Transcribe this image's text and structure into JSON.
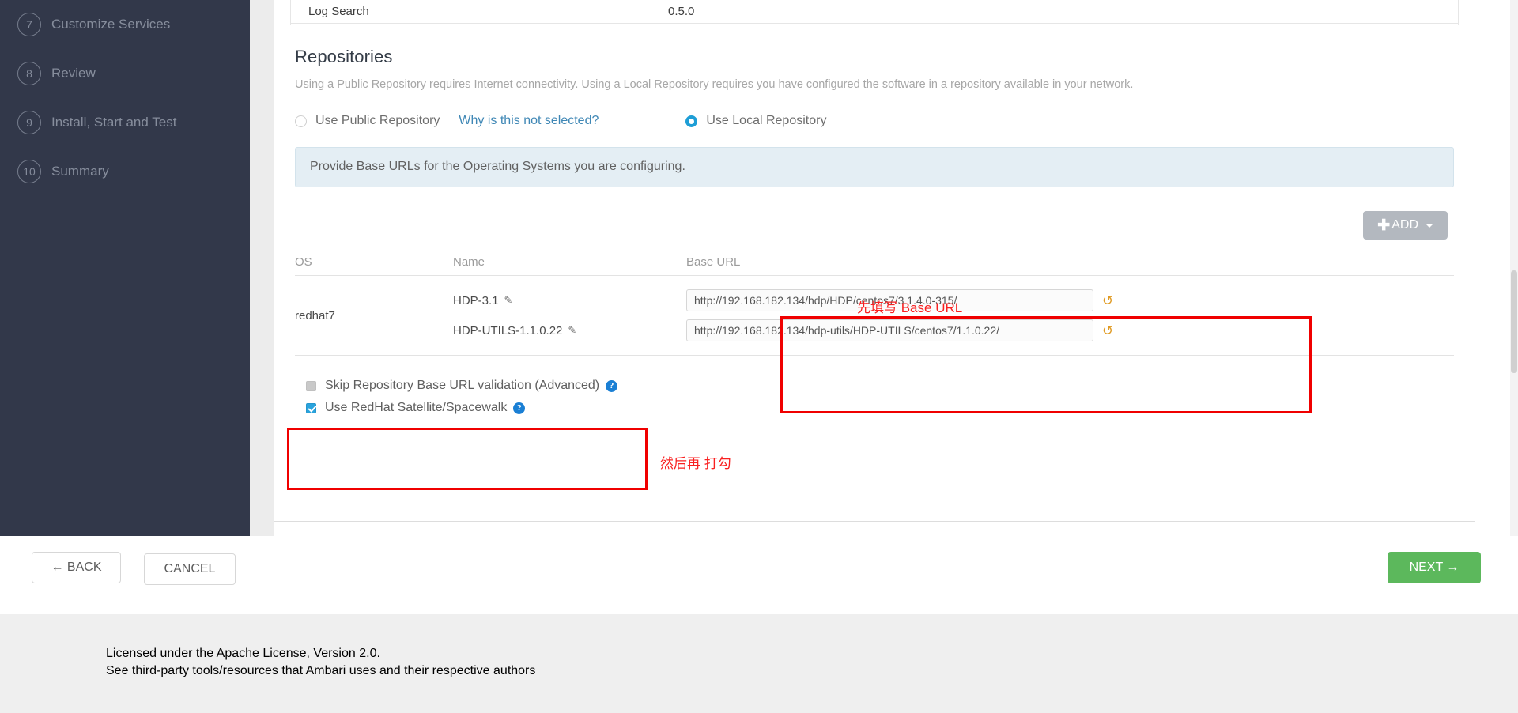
{
  "sidebar": {
    "steps": [
      {
        "num": "7",
        "label": "Customize Services"
      },
      {
        "num": "8",
        "label": "Review"
      },
      {
        "num": "9",
        "label": "Install, Start and Test"
      },
      {
        "num": "10",
        "label": "Summary"
      }
    ]
  },
  "stack_table": {
    "service_name": "Log Search",
    "service_version": "0.5.0"
  },
  "repositories": {
    "title": "Repositories",
    "description": "Using a Public Repository requires Internet connectivity. Using a Local Repository requires you have configured the software in a repository available in your network.",
    "public_radio_label": "Use Public Repository",
    "why_link": "Why is this not selected?",
    "local_radio_label": "Use Local Repository",
    "selected": "local",
    "info_text": "Provide Base URLs for the Operating Systems you are configuring.",
    "add_button": "ADD",
    "columns": {
      "os": "OS",
      "name": "Name",
      "base_url": "Base URL"
    },
    "rows": [
      {
        "os": "redhat7",
        "entries": [
          {
            "name": "HDP-3.1",
            "url": "http://192.168.182.134/hdp/HDP/centos7/3.1.4.0-315/"
          },
          {
            "name": "HDP-UTILS-1.1.0.22",
            "url": "http://192.168.182.134/hdp-utils/HDP-UTILS/centos7/1.1.0.22/"
          }
        ]
      }
    ],
    "checkboxes": [
      {
        "label": "Skip Repository Base URL validation (Advanced)",
        "state": "disabled"
      },
      {
        "label": "Use RedHat Satellite/Spacewalk",
        "state": "checked"
      }
    ]
  },
  "annotations": {
    "base_url_note": "先填写 Base URL",
    "checkbox_note": "然后再 打勾",
    "color": "#f92020"
  },
  "actions": {
    "back": "← BACK",
    "cancel": "CANCEL",
    "next": "NEXT →"
  },
  "footer": {
    "license": "Licensed under the Apache License, Version 2.0.",
    "third_party": "See third-party tools/resources that Ambari uses and their respective authors"
  },
  "icons": {
    "pencil": "✎",
    "undo": "↺",
    "help": "?",
    "plus": "✚"
  }
}
